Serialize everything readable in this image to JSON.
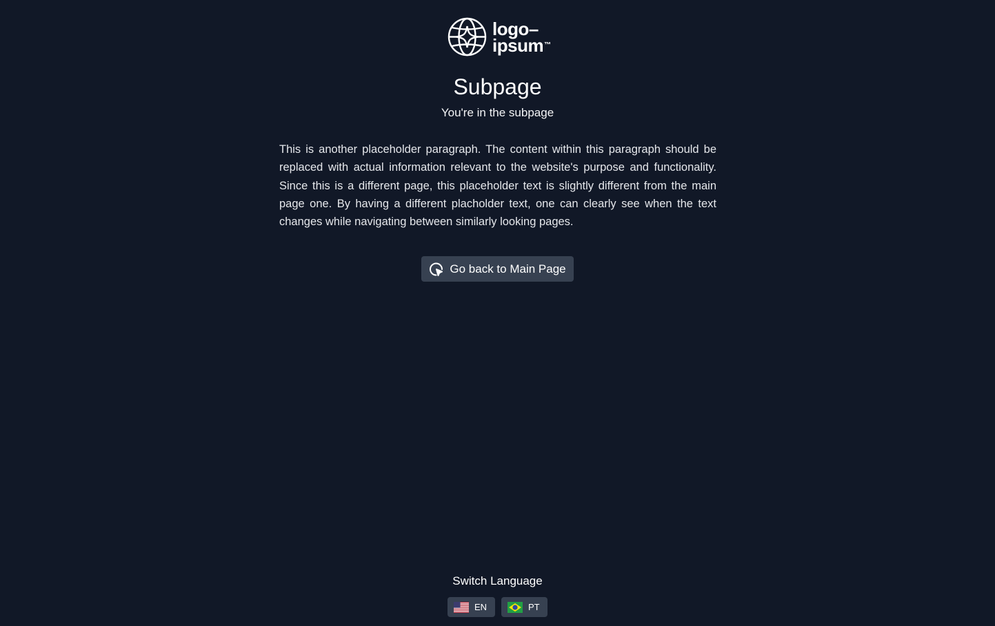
{
  "brand": {
    "logo_line1": "logo",
    "logo_line2": "ipsum",
    "logo_icon": "globe-sparkle-icon"
  },
  "page": {
    "title": "Subpage",
    "subtitle": "You're in the subpage",
    "paragraph": "This is another placeholder paragraph. The content within this paragraph should be replaced with actual information relevant to the website's purpose and functionality. Since this is a different page, this placeholder text is slightly different from the main page one. By having a different placholder text, one can clearly see when the text changes while navigating between similarly looking pages."
  },
  "back_button": {
    "label": "Go back to Main Page",
    "icon": "cursor-click-icon"
  },
  "language": {
    "title": "Switch Language",
    "options": [
      {
        "code": "EN",
        "flag": "us-flag-icon"
      },
      {
        "code": "PT",
        "flag": "br-flag-icon"
      }
    ]
  },
  "colors": {
    "background": "#111827",
    "button": "#374151",
    "text": "#f3f4f6"
  }
}
